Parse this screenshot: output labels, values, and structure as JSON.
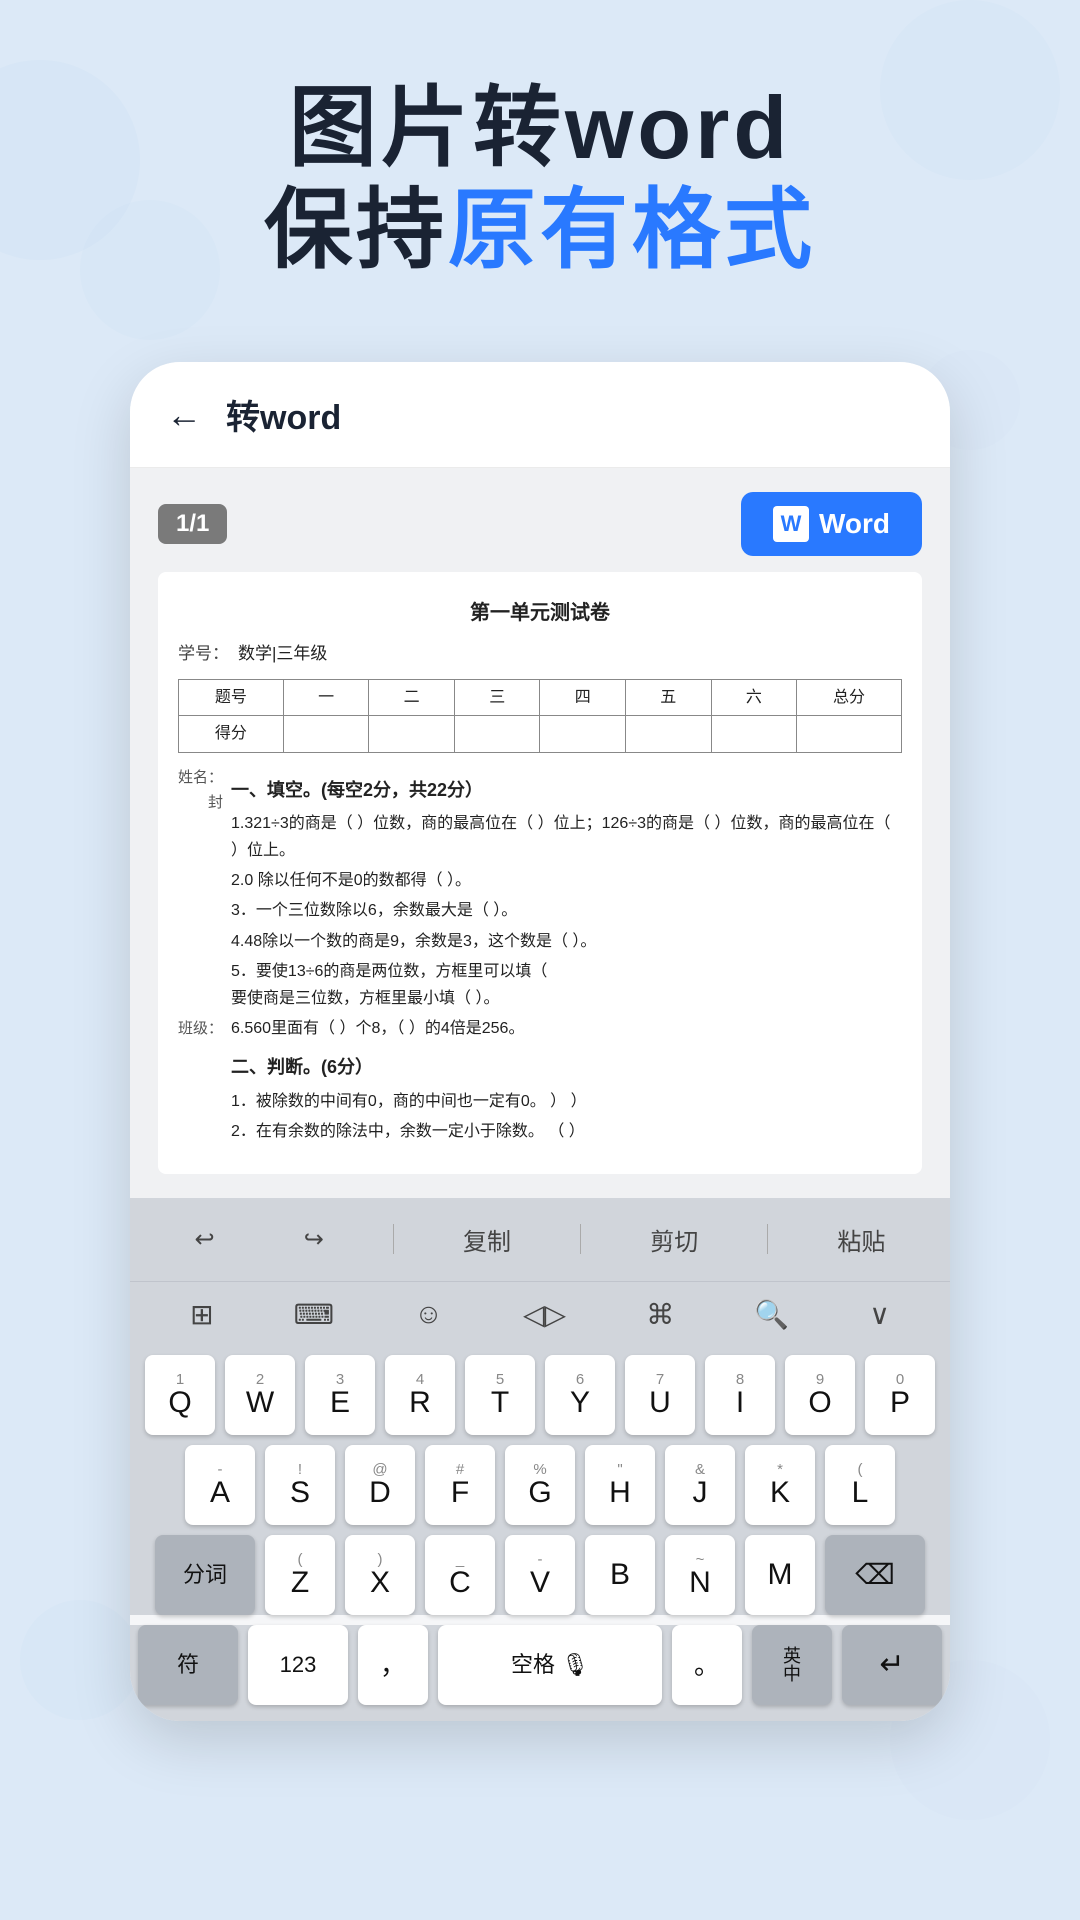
{
  "background": {
    "color": "#dce9f7"
  },
  "header": {
    "line1": "图片转word",
    "line2_before": "保持",
    "line2_blue": "原有格式",
    "accent_color": "#2979ff"
  },
  "navbar": {
    "back_icon": "←",
    "title": "转word"
  },
  "page_controls": {
    "badge": "1/1",
    "word_button_label": "Word",
    "word_button_icon": "W"
  },
  "document": {
    "title": "第一单元测试卷",
    "meta": [
      {
        "label": "学号：",
        "value": "数学|三年级"
      }
    ],
    "table_headers": [
      "题号",
      "一",
      "二",
      "三",
      "四",
      "五",
      "六",
      "总分"
    ],
    "table_row2": [
      "得分",
      "",
      "",
      "",
      "",
      "",
      "",
      ""
    ],
    "sections": [
      {
        "heading": "一、填空。(每空2分，共22分）",
        "items": [
          "1.321÷3的商是（  ）位数，商的最高位在（  ）位上；126÷3的商是（  ）位数，商的最高位在（  ）位上。",
          "2.0 除以任何不是0的数都得（  ）。",
          "3．一个三位数除以6，余数最大是（  ）。",
          "4.48除以一个数的商是9，余数是3，这个数是（  ）。",
          "5．要使13÷6的商是两位数，方框里可以填（  要使商是三位数，方框里最小填（  ）。",
          "6.560里面有（  ）个8，（  ）的4倍是256。"
        ]
      },
      {
        "heading": "二、判断。(6分）",
        "items": [
          "1．被除数的中间有0，商的中间也一定有0。   ）          ）",
          "2．在有余数的除法中，余数一定小于除数。   （  ）"
        ]
      }
    ],
    "sidebar_labels": [
      {
        "position": "姓名：\n封",
        "section": 0
      },
      {
        "position": "班级：",
        "section": 1
      }
    ]
  },
  "keyboard_toolbar": {
    "buttons": [
      "撤销",
      "重做",
      "复制",
      "剪切",
      "粘贴"
    ]
  },
  "keyboard_icons": [
    "⊞",
    "⌨",
    "☺",
    "◁▷",
    "⌘",
    "🔍",
    "∨"
  ],
  "keyboard": {
    "row1": [
      {
        "num": "1",
        "letter": "Q"
      },
      {
        "num": "2",
        "letter": "W"
      },
      {
        "num": "3",
        "letter": "E"
      },
      {
        "num": "4",
        "letter": "R"
      },
      {
        "num": "5",
        "letter": "T"
      },
      {
        "num": "6",
        "letter": "Y"
      },
      {
        "num": "7",
        "letter": "U"
      },
      {
        "num": "8",
        "letter": "I"
      },
      {
        "num": "9",
        "letter": "O"
      },
      {
        "num": "0",
        "letter": "P"
      }
    ],
    "row2": [
      {
        "num": "-",
        "letter": "A"
      },
      {
        "num": "!",
        "letter": "S"
      },
      {
        "num": "@",
        "letter": "D"
      },
      {
        "num": "#",
        "letter": "F"
      },
      {
        "num": "%",
        "letter": "G"
      },
      {
        "num": "\"",
        "letter": "H"
      },
      {
        "num": "&",
        "letter": "J"
      },
      {
        "num": "*",
        "letter": "K"
      },
      {
        "num": "(",
        "letter": "L"
      }
    ],
    "row3": [
      {
        "num": "",
        "letter": "分词",
        "wide": true,
        "dark": true
      },
      {
        "num": "(",
        "letter": "Z"
      },
      {
        "num": ")",
        "letter": "X"
      },
      {
        "num": "_",
        "letter": "C"
      },
      {
        "num": "-",
        "letter": "V"
      },
      {
        "num": "",
        "letter": "B"
      },
      {
        "num": "~",
        "letter": "N"
      },
      {
        "num": "",
        "letter": "M"
      },
      {
        "num": "delete",
        "letter": "⌫",
        "dark": true
      }
    ],
    "row4": [
      {
        "letter": "符",
        "dark": true
      },
      {
        "letter": "123"
      },
      {
        "letter": "，"
      },
      {
        "letter": "空格 🎙",
        "space": true
      },
      {
        "letter": "。"
      },
      {
        "letter": "英\n中",
        "dark": true
      },
      {
        "letter": "↵",
        "dark": true
      }
    ]
  }
}
